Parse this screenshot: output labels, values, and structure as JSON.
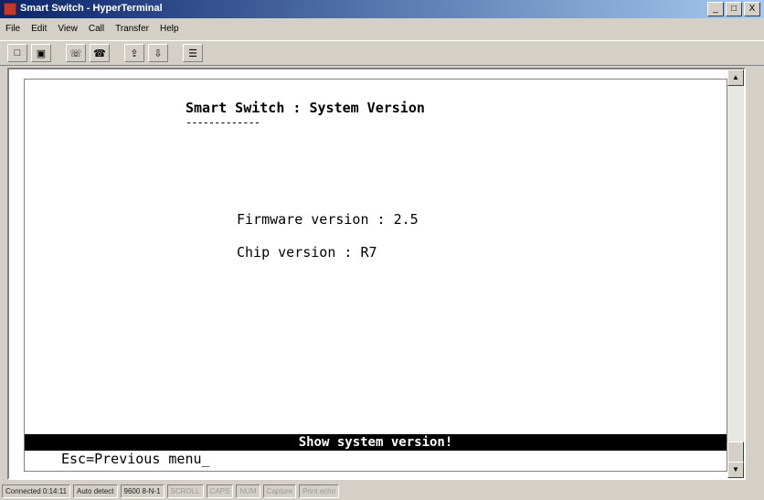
{
  "window": {
    "title": "Smart Switch - HyperTerminal",
    "controls": [
      "_",
      "□",
      "X"
    ]
  },
  "menu": [
    "File",
    "Edit",
    "View",
    "Call",
    "Transfer",
    "Help"
  ],
  "toolbar": [
    {
      "name": "new-icon",
      "glyph": "□"
    },
    {
      "name": "open-icon",
      "glyph": "▣"
    },
    {
      "name": "connect-icon",
      "glyph": "☏"
    },
    {
      "name": "disconnect-icon",
      "glyph": "☎"
    },
    {
      "name": "send-icon",
      "glyph": "⇪"
    },
    {
      "name": "receive-icon",
      "glyph": "⇩"
    },
    {
      "name": "properties-icon",
      "glyph": "☰"
    }
  ],
  "terminal": {
    "title": "Smart Switch : System Version",
    "underline": "-------------",
    "firmware_line": "Firmware version : 2.5",
    "chip_line": "Chip version : R7",
    "status_message": "Show system version!",
    "prompt": "Esc=Previous menu_"
  },
  "statusbar": {
    "connected": "Connected 0:14:11",
    "detect": "Auto detect",
    "settings": "9600 8-N-1",
    "scroll": "SCROLL",
    "caps": "CAPS",
    "num": "NUM",
    "capture": "Capture",
    "print_echo": "Print echo"
  }
}
